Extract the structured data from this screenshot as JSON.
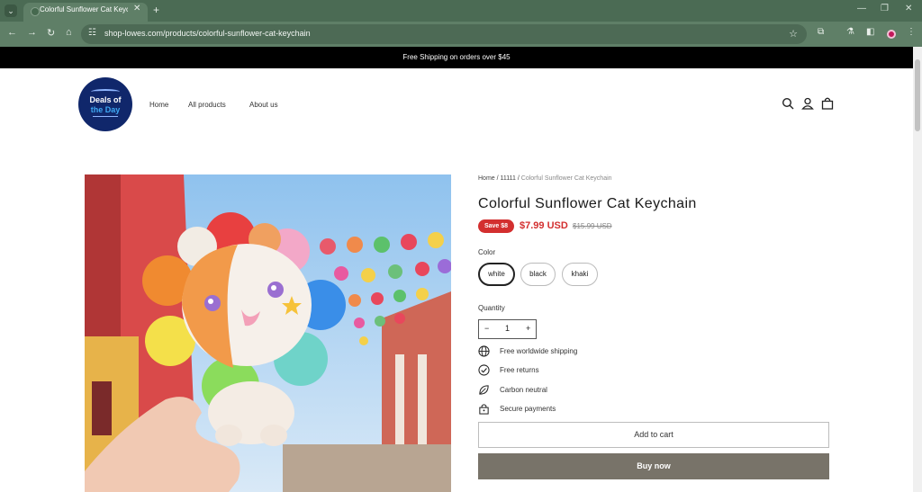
{
  "browser": {
    "tab_title": "Colorful Sunflower Cat Keychain",
    "url": "shop-lowes.com/products/colorful-sunflower-cat-keychain"
  },
  "announcement": "Free Shipping on orders over $45",
  "logo": {
    "line1": "Deals of",
    "line2": "the Day"
  },
  "nav": {
    "home": "Home",
    "all_products": "All products",
    "about": "About us"
  },
  "breadcrumb": {
    "home": "Home",
    "sep1": " / ",
    "collection": "11111",
    "sep2": " / ",
    "current": "Colorful Sunflower Cat Keychain"
  },
  "product": {
    "title": "Colorful Sunflower Cat Keychain",
    "save_badge": "Save $8",
    "price": "$7.99 USD",
    "compare_price": "$15.99 USD"
  },
  "color": {
    "label": "Color",
    "options": [
      "white",
      "black",
      "khaki"
    ],
    "selected": "white"
  },
  "quantity": {
    "label": "Quantity",
    "value": "1",
    "minus": "−",
    "plus": "+"
  },
  "features": [
    "Free worldwide shipping",
    "Free returns",
    "Carbon neutral",
    "Secure payments"
  ],
  "buttons": {
    "add_to_cart": "Add to cart",
    "buy_now": "Buy now"
  },
  "colors": {
    "accent_red": "#d32f2f",
    "buy_button": "#787369",
    "logo_blue": "#10276b",
    "chrome_green": "#5f7f67"
  }
}
